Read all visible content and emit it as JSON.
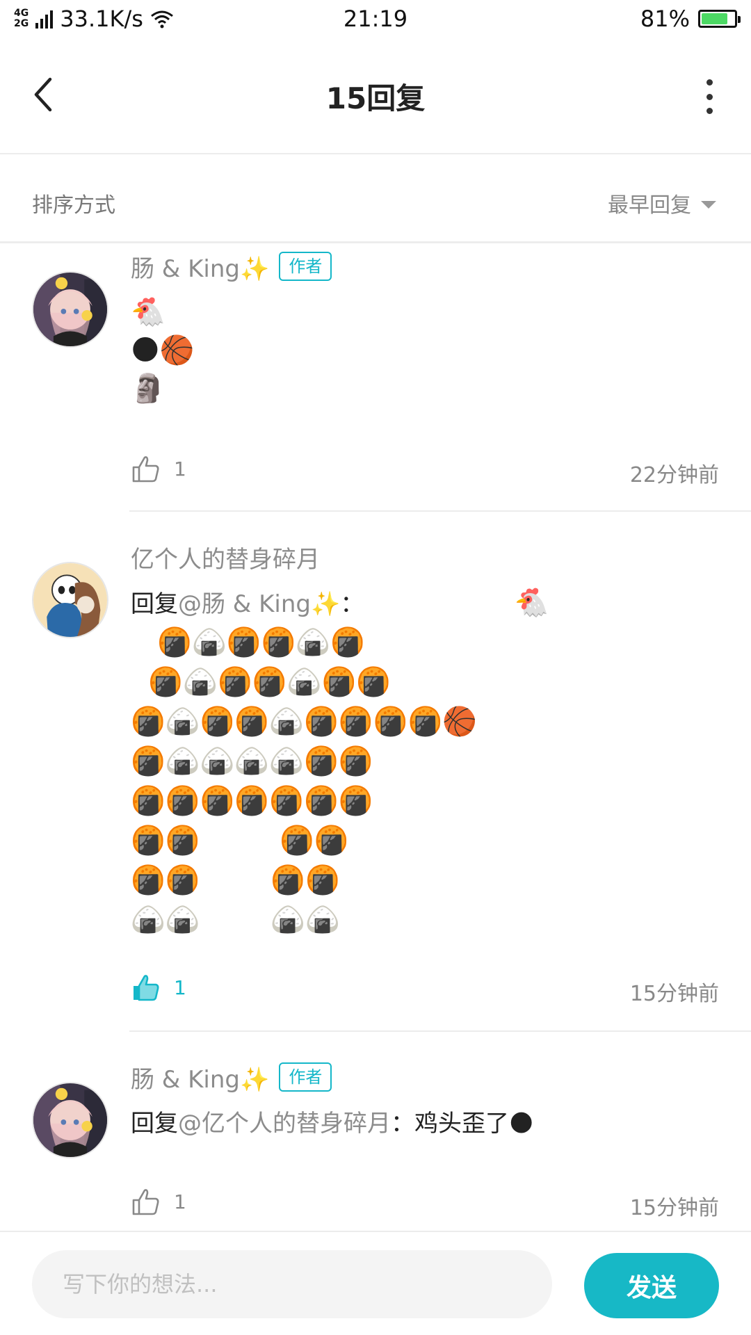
{
  "status_bar": {
    "network": "4G 2G",
    "speed": "33.1K/s",
    "time": "21:19",
    "battery_percent": "81%",
    "battery_level": 0.81
  },
  "header": {
    "title": "15回复"
  },
  "sort": {
    "label": "排序方式",
    "selected": "最早回复"
  },
  "replies": [
    {
      "author": "肠 & King✨",
      "badge": "作者",
      "content": "🐔\n🌑🏀\n🗿",
      "likes": "1",
      "liked": false,
      "time": "22分钟前"
    },
    {
      "author": "亿个人的替身碎月",
      "reply_prefix": "回复",
      "reply_to": "@肠 & King✨",
      "reply_sep": "：",
      "content": "                 🐔\n   🍘🍙🍘🍘🍙🍘\n  🍘🍙🍘🍘🍙🍘🍘\n🍘🍙🍘🍘🍙🍘🍘🍘🍘🏀\n🍘🍙🍙🍙🍙🍘🍘\n🍘🍘🍘🍘🍘🍘🍘\n🍘🍘         🍘🍘\n🍘🍘        🍘🍘\n🍙🍙        🍙🍙",
      "likes": "1",
      "liked": true,
      "time": "15分钟前"
    },
    {
      "author": "肠 & King✨",
      "badge": "作者",
      "reply_prefix": "回复",
      "reply_to": "@亿个人的替身碎月",
      "reply_sep": "：",
      "content": "鸡头歪了🌑",
      "likes": "1",
      "liked": false,
      "time": "15分钟前"
    }
  ],
  "composer": {
    "placeholder": "写下你的想法...",
    "send_label": "发送"
  },
  "colors": {
    "accent": "#17b8c6",
    "muted_text": "#8c8c8c"
  }
}
